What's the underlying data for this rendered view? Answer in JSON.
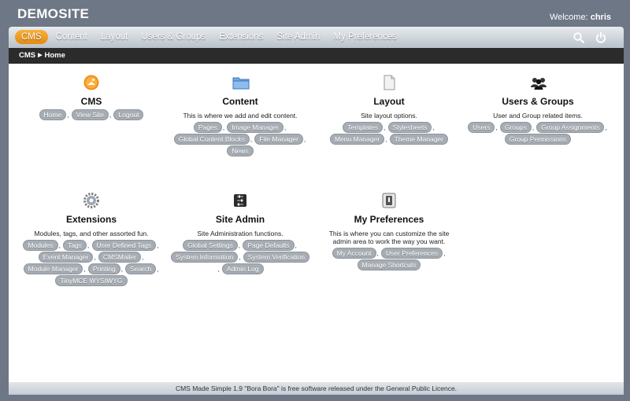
{
  "header": {
    "site_title": "DEMOSITE",
    "welcome_label": "Welcome:",
    "username": "chris"
  },
  "nav": {
    "items": [
      {
        "label": "CMS",
        "active": true
      },
      {
        "label": "Content"
      },
      {
        "label": "Layout"
      },
      {
        "label": "Users & Groups"
      },
      {
        "label": "Extensions"
      },
      {
        "label": "Site Admin"
      },
      {
        "label": "My Preferences"
      }
    ],
    "icons": [
      "search-icon",
      "power-icon"
    ]
  },
  "breadcrumb": [
    "CMS",
    "Home"
  ],
  "sections": [
    {
      "id": "cms",
      "icon": "cms-logo-icon",
      "title": "CMS",
      "desc": "",
      "links": [
        "Home",
        "View Site",
        "Logout"
      ]
    },
    {
      "id": "content",
      "icon": "folder-icon",
      "title": "Content",
      "desc": "This is where we add and edit content.",
      "links": [
        "Pages",
        "Image Manager",
        "Global Content Blocks",
        "File Manager",
        "News"
      ]
    },
    {
      "id": "layout",
      "icon": "page-icon",
      "title": "Layout",
      "desc": "Site layout options.",
      "links": [
        "Templates",
        "Stylesheets",
        "Menu Manager",
        "Theme Manager"
      ]
    },
    {
      "id": "users",
      "icon": "users-icon",
      "title": "Users & Groups",
      "desc": "User and Group related items.",
      "links": [
        "Users",
        "Groups",
        "Group Assignments",
        "Group Permissions"
      ]
    },
    {
      "id": "extensions",
      "icon": "gear-icon",
      "title": "Extensions",
      "desc": "Modules, tags, and other assorted fun.",
      "links": [
        "Modules",
        "Tags",
        "User Defined Tags",
        "Event Manager",
        "CMSMailer",
        "Module Manager",
        "Printing",
        "Search",
        "TinyMCE WYSIWYG"
      ]
    },
    {
      "id": "siteadmin",
      "icon": "sliders-icon",
      "title": "Site Admin",
      "desc": "Site Administration functions.",
      "links": [
        "Global Settings",
        "Page Defaults",
        "System Information",
        "System Verification",
        "Admin Log"
      ]
    },
    {
      "id": "prefs",
      "icon": "preferences-icon",
      "title": "My Preferences",
      "desc": "This is where you can customize the site admin area to work the way you want.",
      "links": [
        "My Account",
        "User Preferences",
        "Manage Shortcuts"
      ]
    }
  ],
  "footer": {
    "text": "CMS Made Simple 1.9 \"Bora Bora\" is free software released under the General Public Licence."
  }
}
